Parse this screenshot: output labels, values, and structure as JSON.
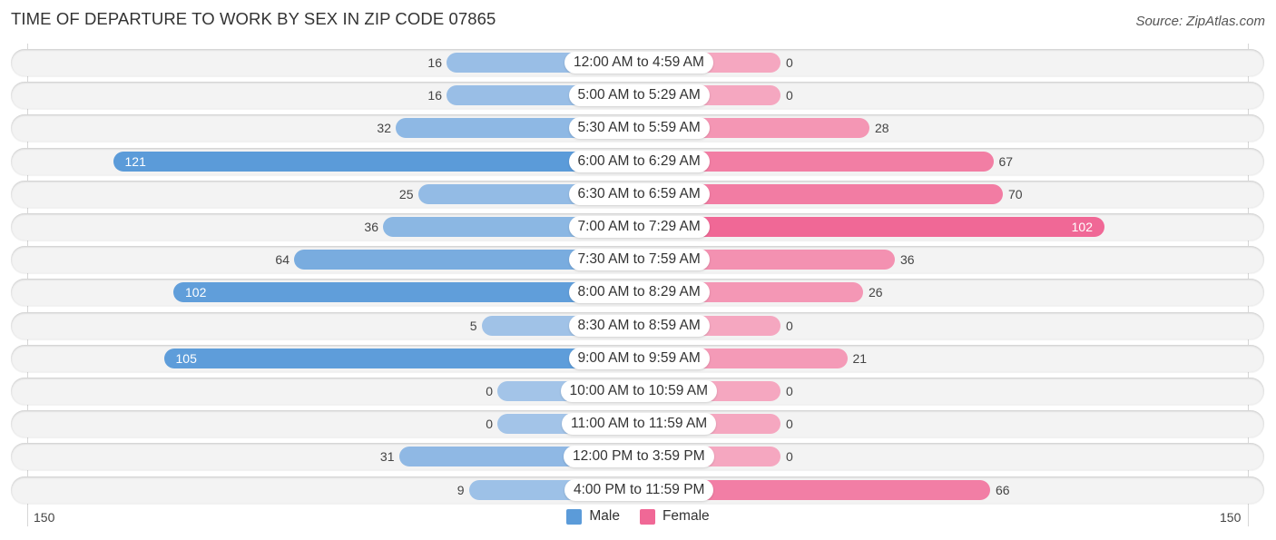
{
  "title": "TIME OF DEPARTURE TO WORK BY SEX IN ZIP CODE 07865",
  "source": "Source: ZipAtlas.com",
  "colors": {
    "male_light": "#a3c4e8",
    "male_dark": "#5b9bd9",
    "female_light": "#f5a7c0",
    "female_dark": "#f06896",
    "row_background": "#f3f3f3"
  },
  "chart_data": {
    "type": "bar",
    "orientation": "horizontal-diverging",
    "title": "TIME OF DEPARTURE TO WORK BY SEX IN ZIP CODE 07865",
    "categories": [
      "12:00 AM to 4:59 AM",
      "5:00 AM to 5:29 AM",
      "5:30 AM to 5:59 AM",
      "6:00 AM to 6:29 AM",
      "6:30 AM to 6:59 AM",
      "7:00 AM to 7:29 AM",
      "7:30 AM to 7:59 AM",
      "8:00 AM to 8:29 AM",
      "8:30 AM to 8:59 AM",
      "9:00 AM to 9:59 AM",
      "10:00 AM to 10:59 AM",
      "11:00 AM to 11:59 AM",
      "12:00 PM to 3:59 PM",
      "4:00 PM to 11:59 PM"
    ],
    "series": [
      {
        "name": "Male",
        "values": [
          16,
          16,
          32,
          121,
          25,
          36,
          64,
          102,
          5,
          105,
          0,
          0,
          31,
          9
        ]
      },
      {
        "name": "Female",
        "values": [
          0,
          0,
          28,
          67,
          70,
          102,
          36,
          26,
          0,
          21,
          0,
          0,
          0,
          66
        ]
      }
    ],
    "axis": {
      "left_tick_label": "150",
      "right_tick_label": "150",
      "range": [
        0,
        150
      ]
    },
    "legend": {
      "entries": [
        "Male",
        "Female"
      ],
      "placement": "bottom-center"
    },
    "xlabel": "",
    "ylabel": "",
    "grid": false
  }
}
